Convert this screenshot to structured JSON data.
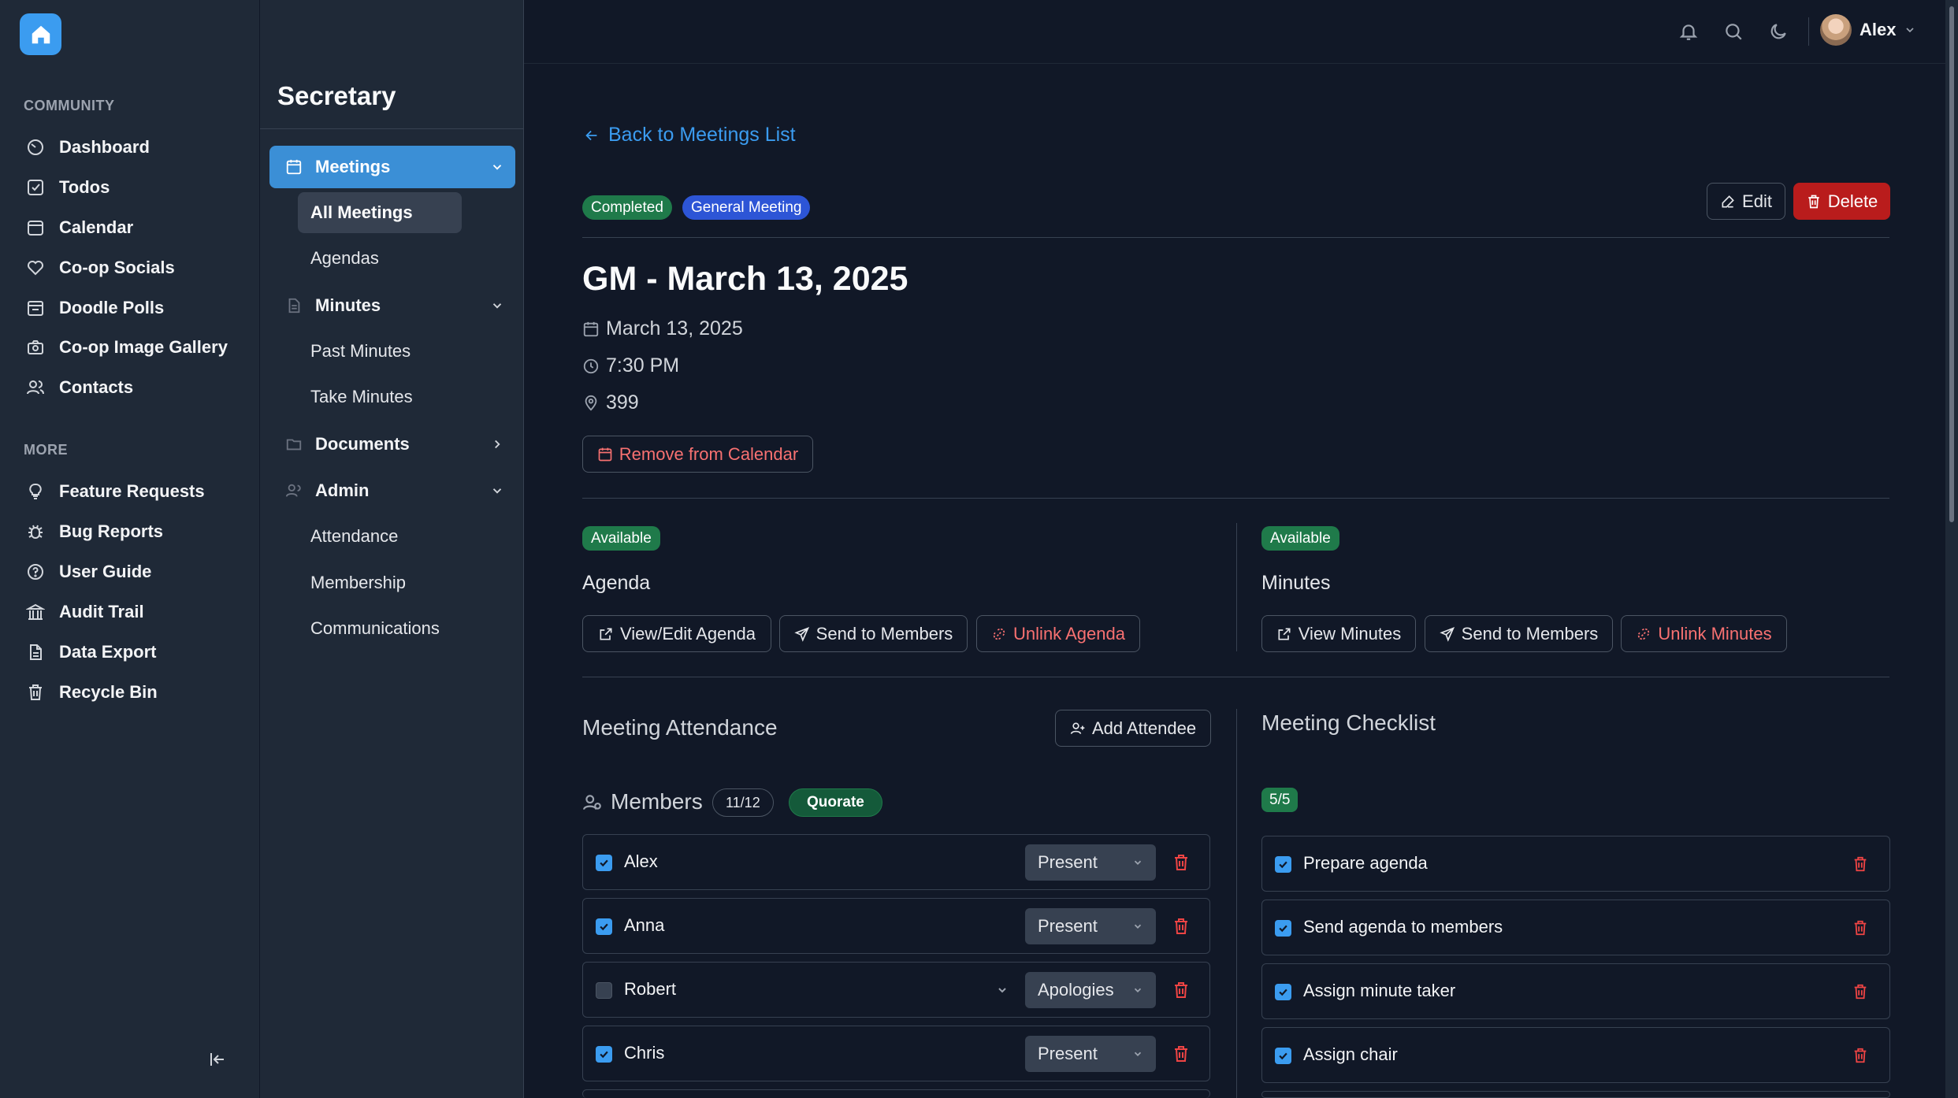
{
  "app": {
    "brand_color": "#3b9cf0"
  },
  "leftnav": {
    "section_community": "COMMUNITY",
    "section_more": "MORE",
    "community_items": [
      {
        "label": "Dashboard",
        "icon": "dashboard-icon"
      },
      {
        "label": "Todos",
        "icon": "checkbox-icon"
      },
      {
        "label": "Calendar",
        "icon": "calendar-icon"
      },
      {
        "label": "Co-op Socials",
        "icon": "heart-icon"
      },
      {
        "label": "Doodle Polls",
        "icon": "poll-calendar-icon"
      },
      {
        "label": "Co-op Image Gallery",
        "icon": "camera-icon"
      },
      {
        "label": "Contacts",
        "icon": "users-icon"
      }
    ],
    "more_items": [
      {
        "label": "Feature Requests",
        "icon": "lightbulb-icon"
      },
      {
        "label": "Bug Reports",
        "icon": "bug-icon"
      },
      {
        "label": "User Guide",
        "icon": "help-circle-icon"
      },
      {
        "label": "Audit Trail",
        "icon": "audit-icon"
      },
      {
        "label": "Data Export",
        "icon": "file-icon"
      },
      {
        "label": "Recycle Bin",
        "icon": "trash-icon"
      }
    ]
  },
  "subnav": {
    "title": "Secretary",
    "meetings": "Meetings",
    "all_meetings": "All Meetings",
    "agendas": "Agendas",
    "minutes": "Minutes",
    "past_minutes": "Past Minutes",
    "take_minutes": "Take Minutes",
    "documents": "Documents",
    "admin": "Admin",
    "attendance": "Attendance",
    "membership": "Membership",
    "communications": "Communications"
  },
  "topbar": {
    "user_name": "Alex"
  },
  "meeting": {
    "back_link": "Back to Meetings List",
    "status_badge": "Completed",
    "type_badge": "General Meeting",
    "edit_label": "Edit",
    "delete_label": "Delete",
    "title": "GM - March 13, 2025",
    "date": "March 13, 2025",
    "time": "7:30 PM",
    "location": "399",
    "remove_calendar": "Remove from Calendar"
  },
  "agenda": {
    "badge": "Available",
    "heading": "Agenda",
    "view_edit": "View/Edit Agenda",
    "send": "Send to Members",
    "unlink": "Unlink Agenda"
  },
  "minutes": {
    "badge": "Available",
    "heading": "Minutes",
    "view": "View Minutes",
    "send": "Send to Members",
    "unlink": "Unlink Minutes"
  },
  "attendance": {
    "title": "Meeting Attendance",
    "add_attendee": "Add Attendee",
    "members_label": "Members",
    "count": "11/12",
    "quorate": "Quorate",
    "rows": [
      {
        "name": "Alex",
        "checked": true,
        "status": "Present"
      },
      {
        "name": "Anna",
        "checked": true,
        "status": "Present"
      },
      {
        "name": "Robert",
        "checked": false,
        "status": "Apologies"
      },
      {
        "name": "Chris",
        "checked": true,
        "status": "Present"
      }
    ]
  },
  "checklist": {
    "title": "Meeting Checklist",
    "progress": "5/5",
    "items": [
      {
        "label": "Prepare agenda",
        "checked": true
      },
      {
        "label": "Send agenda to members",
        "checked": true
      },
      {
        "label": "Assign minute taker",
        "checked": true
      },
      {
        "label": "Assign chair",
        "checked": true
      }
    ]
  }
}
